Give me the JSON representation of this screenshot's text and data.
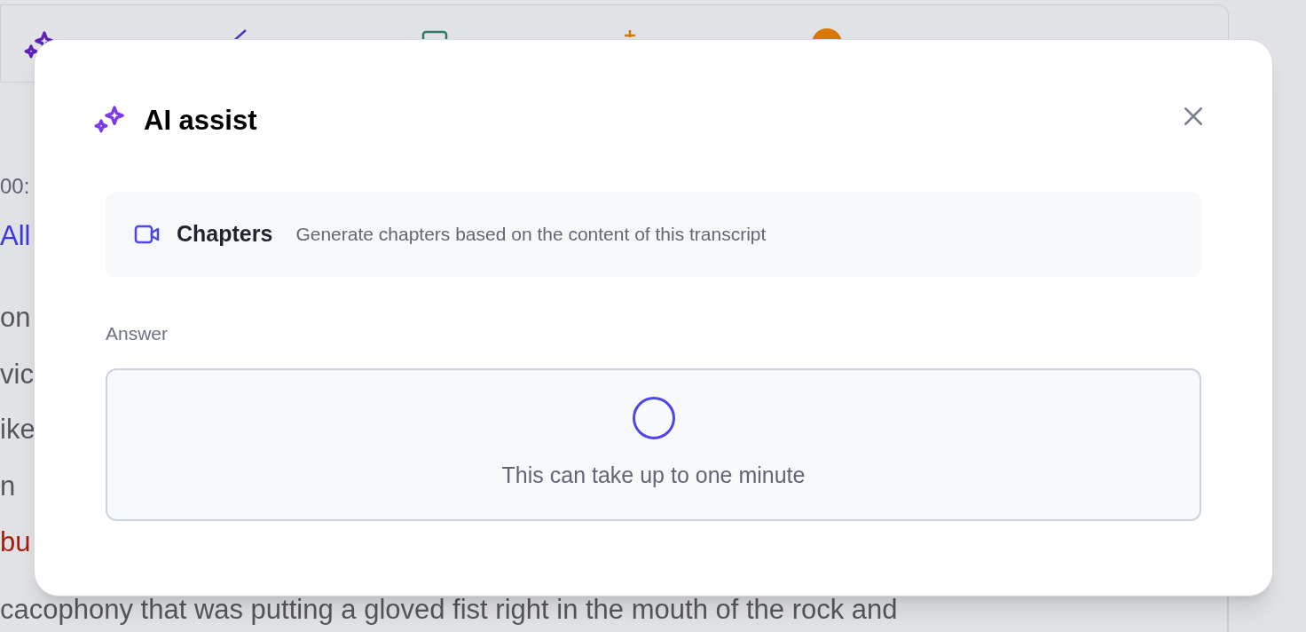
{
  "background": {
    "lines": [
      {
        "text": "00:",
        "kind": "time"
      },
      {
        "text": "All",
        "kind": "speaker"
      },
      {
        "text": "on",
        "kind": "body"
      },
      {
        "text": "vic",
        "kind": "body"
      },
      {
        "text": "ike",
        "kind": "body"
      },
      {
        "text": "n",
        "kind": "body"
      },
      {
        "text": "bu",
        "kind": "flagged"
      },
      {
        "text": "cacophony that was putting a gloved fist right in the mouth of the rock and",
        "kind": "body"
      }
    ]
  },
  "dialog": {
    "title": "AI assist",
    "task": {
      "title": "Chapters",
      "description": "Generate chapters based on the content of this transcript"
    },
    "answer": {
      "label": "Answer",
      "loading": true,
      "message": "This can take up to one minute"
    }
  }
}
